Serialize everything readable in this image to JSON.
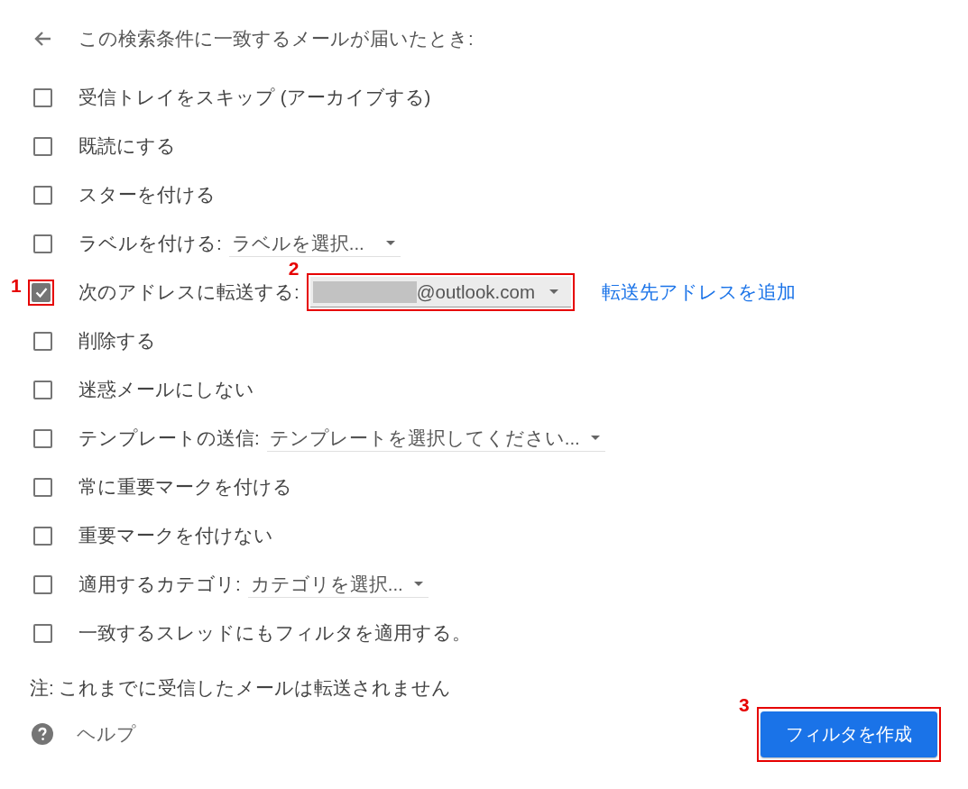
{
  "header": {
    "title": "この検索条件に一致するメールが届いたとき:"
  },
  "actions": [
    {
      "kind": "plain",
      "label": "受信トレイをスキップ (アーカイブする)",
      "checked": false
    },
    {
      "kind": "plain",
      "label": "既読にする",
      "checked": false
    },
    {
      "kind": "plain",
      "label": "スターを付ける",
      "checked": false
    },
    {
      "kind": "select",
      "label": "ラベルを付ける:",
      "checked": false,
      "select": {
        "value": "ラベルを選択...",
        "focused": false
      }
    },
    {
      "kind": "select",
      "label": "次のアドレスに転送する:",
      "checked": true,
      "callout": "1",
      "select": {
        "value": "@outlook.com",
        "redacted": true,
        "focused": true,
        "callout": "2"
      },
      "link": "転送先アドレスを追加"
    },
    {
      "kind": "plain",
      "label": "削除する",
      "checked": false
    },
    {
      "kind": "plain",
      "label": "迷惑メールにしない",
      "checked": false
    },
    {
      "kind": "select",
      "label": "テンプレートの送信:",
      "checked": false,
      "select": {
        "value": "テンプレートを選択してください...",
        "focused": false
      }
    },
    {
      "kind": "plain",
      "label": "常に重要マークを付ける",
      "checked": false
    },
    {
      "kind": "plain",
      "label": "重要マークを付けない",
      "checked": false
    },
    {
      "kind": "select",
      "label": "適用するカテゴリ:",
      "checked": false,
      "select": {
        "value": "カテゴリを選択...",
        "focused": false
      }
    },
    {
      "kind": "plain",
      "label": "一致するスレッドにもフィルタを適用する。",
      "checked": false
    }
  ],
  "note": "注: これまでに受信したメールは転送されません",
  "help": {
    "label": "ヘルプ"
  },
  "create_button": {
    "label": "フィルタを作成",
    "callout": "3"
  }
}
